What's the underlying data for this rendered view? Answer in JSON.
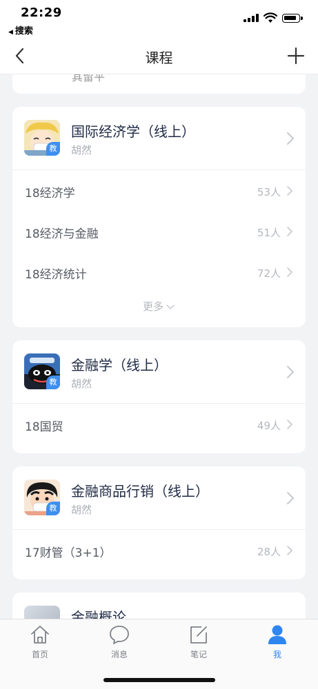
{
  "status_bar": {
    "time": "22:29",
    "back_app": "搜索"
  },
  "nav": {
    "title": "课程"
  },
  "partial_card": {
    "text": "其留平"
  },
  "courses": [
    {
      "title": "国际经济学（线上）",
      "teacher": "胡然",
      "badge": "教",
      "classes": [
        {
          "name": "18经济学",
          "count": "53人"
        },
        {
          "name": "18经济与金融",
          "count": "51人"
        },
        {
          "name": "18经济统计",
          "count": "72人"
        }
      ],
      "more_label": "更多"
    },
    {
      "title": "金融学（线上）",
      "teacher": "胡然",
      "badge": "教",
      "classes": [
        {
          "name": "18国贸",
          "count": "49人"
        }
      ]
    },
    {
      "title": "金融商品行销（线上）",
      "teacher": "胡然",
      "badge": "教",
      "classes": [
        {
          "name": "17财管（3+1）",
          "count": "28人"
        }
      ]
    },
    {
      "title": "金融概论"
    }
  ],
  "tabs": [
    {
      "label": "首页",
      "icon": "home-icon",
      "active": false
    },
    {
      "label": "消息",
      "icon": "message-icon",
      "active": false
    },
    {
      "label": "笔记",
      "icon": "note-icon",
      "active": false
    },
    {
      "label": "我",
      "icon": "user-icon",
      "active": true
    }
  ],
  "colors": {
    "accent": "#2f86ef",
    "title": "#1f2a44",
    "muted": "#b3b7bd",
    "background": "#f2f3f5"
  }
}
